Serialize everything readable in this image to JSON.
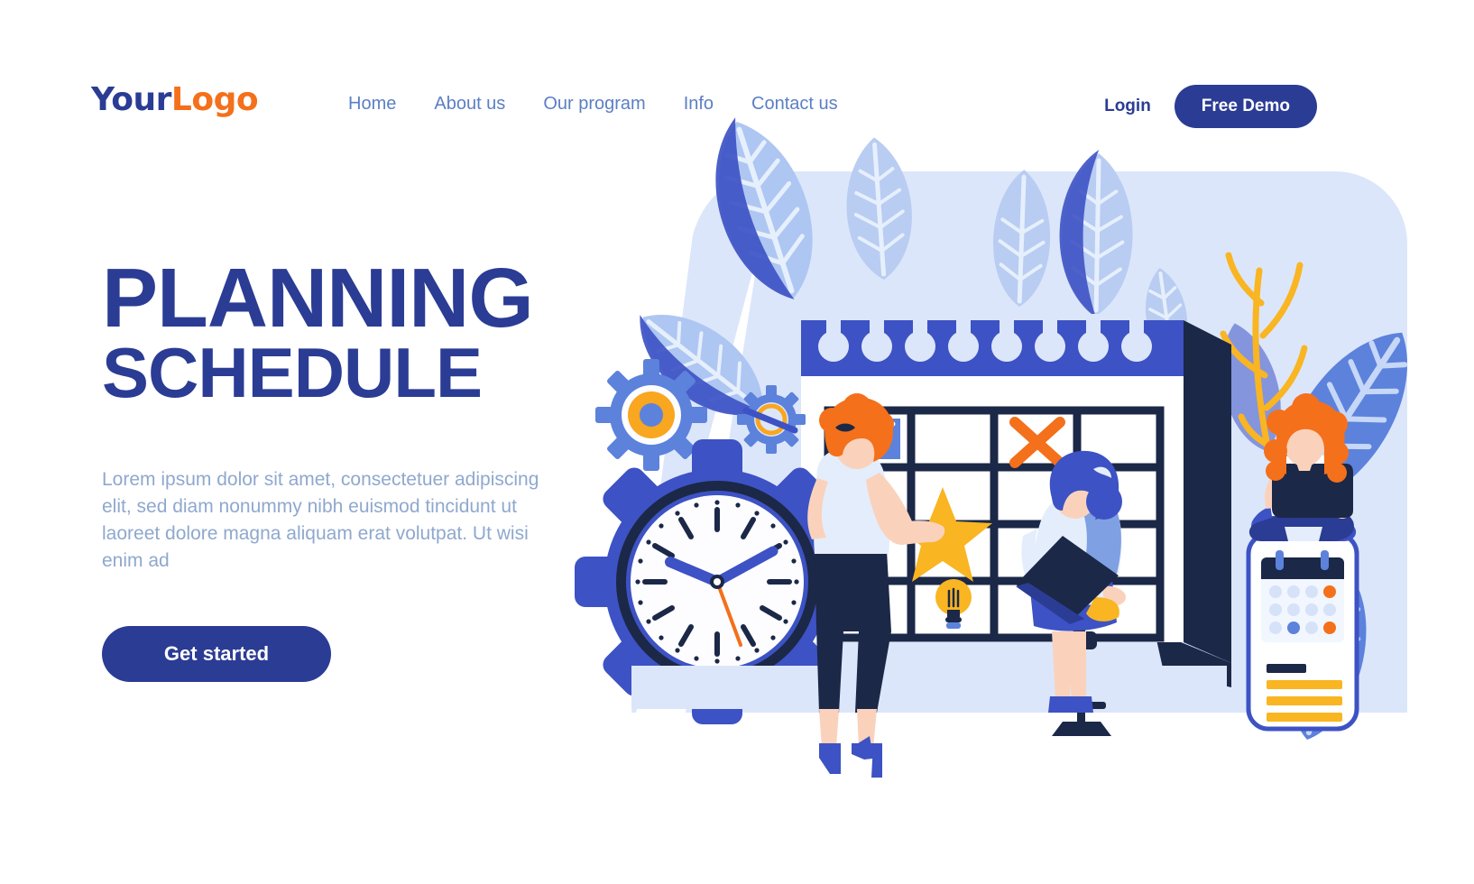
{
  "header": {
    "logo": {
      "part1": "Your",
      "part2": "Logo"
    },
    "nav": [
      {
        "label": "Home"
      },
      {
        "label": "About us"
      },
      {
        "label": "Our program"
      },
      {
        "label": "Info"
      },
      {
        "label": "Contact us"
      }
    ],
    "login_label": "Login",
    "demo_label": "Free Demo"
  },
  "hero": {
    "title_line1": "PLANNING",
    "title_line2": "SCHEDULE",
    "paragraph": "Lorem ipsum dolor sit amet, consectetuer adipiscing elit, sed diam nonummy nibh euismod tincidunt ut laoreet dolore magna aliquam erat volutpat. Ut wisi enim ad",
    "cta_label": "Get started"
  },
  "illustration": {
    "name": "planning-schedule-illustration",
    "elements": [
      "background-blob",
      "leaf-fronds",
      "yellow-sprig",
      "gear-large-clock",
      "gear-medium",
      "gear-small",
      "wall-calendar",
      "calendar-grid",
      "chart-thumbnail",
      "orange-cross-mark",
      "yellow-star",
      "light-bulb",
      "standing-woman",
      "seated-woman-laptop",
      "stool",
      "phone-calendar",
      "woman-on-phone-laptop"
    ]
  },
  "colors": {
    "brand_blue": "#2B3C94",
    "brand_orange": "#F4701B",
    "nav_blue": "#5B7FC4",
    "body_text": "#8FA8CE",
    "bg_light_blue": "#DCE6FA",
    "mid_blue": "#3D52C4",
    "light_periwinkle": "#B9CCF2",
    "navy_dark": "#1B2847",
    "yellow": "#F9B522",
    "white": "#FFFFFF"
  },
  "clock": {
    "hour_hand": "10",
    "minute_hand": "2",
    "second_hand_color": "#F4701B"
  }
}
